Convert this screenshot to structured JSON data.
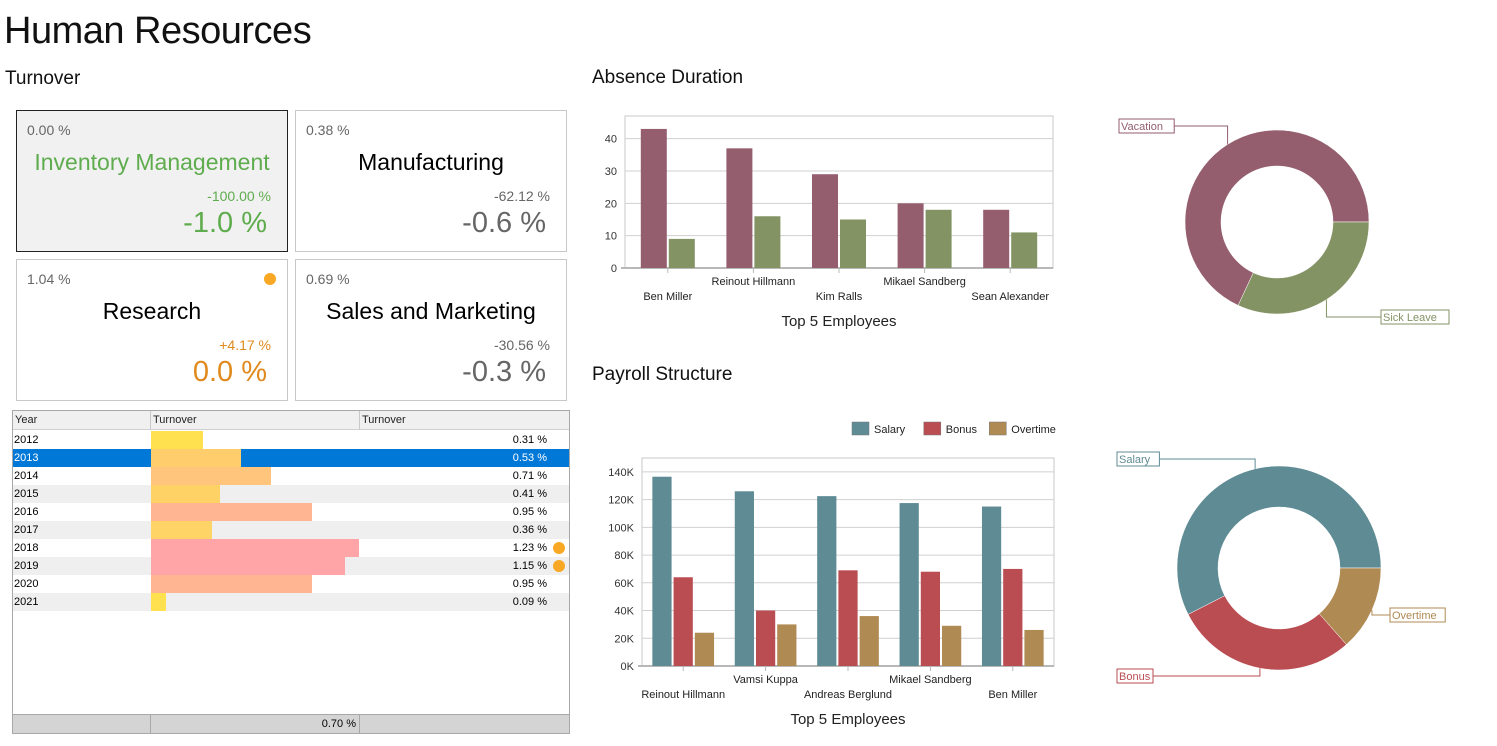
{
  "page": {
    "title": "Human Resources"
  },
  "turnover": {
    "title": "Turnover",
    "cards": [
      {
        "top_value": "0.00 %",
        "name": "Inventory Management",
        "delta": "-100.00 %",
        "value": "-1.0 %",
        "color": "#5fac4e",
        "name_color": "#5fac4e",
        "selected": true,
        "indicator": false
      },
      {
        "top_value": "0.38 %",
        "name": "Manufacturing",
        "delta": "-62.12 %",
        "value": "-0.6 %",
        "color": "#666666",
        "name_color": "#000000",
        "selected": false,
        "indicator": false
      },
      {
        "top_value": "1.04 %",
        "name": "Research",
        "delta": "+4.17 %",
        "value": "0.0 %",
        "color": "#e08a1e",
        "name_color": "#000000",
        "selected": false,
        "indicator": true
      },
      {
        "top_value": "0.69 %",
        "name": "Sales and Marketing",
        "delta": "-30.56 %",
        "value": "-0.3 %",
        "color": "#666666",
        "name_color": "#000000",
        "selected": false,
        "indicator": false
      }
    ],
    "grid": {
      "columns": [
        "Year",
        "Turnover",
        "Turnover"
      ],
      "rows": [
        {
          "year": "2012",
          "value": 0.31,
          "label": "0.31 %",
          "bar_color": "#ffe14f",
          "alert": false
        },
        {
          "year": "2013",
          "value": 0.53,
          "label": "0.53 %",
          "bar_color": "#ffcd6b",
          "alert": false,
          "selected": true
        },
        {
          "year": "2014",
          "value": 0.71,
          "label": "0.71 %",
          "bar_color": "#ffc57d",
          "alert": false
        },
        {
          "year": "2015",
          "value": 0.41,
          "label": "0.41 %",
          "bar_color": "#ffd266",
          "alert": false
        },
        {
          "year": "2016",
          "value": 0.95,
          "label": "0.95 %",
          "bar_color": "#ffb591",
          "alert": false
        },
        {
          "year": "2017",
          "value": 0.36,
          "label": "0.36 %",
          "bar_color": "#ffd466",
          "alert": false
        },
        {
          "year": "2018",
          "value": 1.23,
          "label": "1.23 %",
          "bar_color": "#ffa5a8",
          "alert": true
        },
        {
          "year": "2019",
          "value": 1.15,
          "label": "1.15 %",
          "bar_color": "#ffa5a8",
          "alert": true
        },
        {
          "year": "2020",
          "value": 0.95,
          "label": "0.95 %",
          "bar_color": "#ffb591",
          "alert": false
        },
        {
          "year": "2021",
          "value": 0.09,
          "label": "0.09 %",
          "bar_color": "#ffe14f",
          "alert": false
        }
      ],
      "footer_total": "0.70 %",
      "selected_color": "#0078d7",
      "alert_color": "#f9a825"
    }
  },
  "absence": {
    "title": "Absence Duration"
  },
  "payroll": {
    "title": "Payroll Structure"
  },
  "chart_data": [
    {
      "id": "absence-bar",
      "type": "bar",
      "title": "",
      "xlabel": "Top 5 Employees",
      "ylabel": "",
      "categories": [
        "Ben Miller",
        "Reinout Hillmann",
        "Kim Ralls",
        "Mikael Sandberg",
        "Sean Alexander"
      ],
      "series": [
        {
          "name": "Vacation",
          "color": "#955e6f",
          "values": [
            43,
            37,
            29,
            20,
            18
          ]
        },
        {
          "name": "Sick Leave",
          "color": "#849364",
          "values": [
            9,
            16,
            15,
            18,
            11
          ]
        }
      ],
      "yticks": [
        0,
        10,
        20,
        30,
        40
      ],
      "ytick_labels": [
        "0",
        "10",
        "20",
        "30",
        "40"
      ],
      "ylim": [
        0,
        47
      ],
      "grid": true,
      "legend": "none"
    },
    {
      "id": "absence-donut",
      "type": "pie",
      "donut": true,
      "labels": [
        "Vacation",
        "Sick Leave"
      ],
      "values": [
        147,
        69
      ],
      "colors": [
        "#955e6f",
        "#849364"
      ]
    },
    {
      "id": "payroll-bar",
      "type": "bar",
      "title": "",
      "xlabel": "Top 5 Employees",
      "ylabel": "",
      "categories": [
        "Reinout Hillmann",
        "Vamsi Kuppa",
        "Andreas Berglund",
        "Mikael Sandberg",
        "Ben Miller"
      ],
      "series": [
        {
          "name": "Salary",
          "color": "#5f8b95",
          "values": [
            136500,
            126000,
            122500,
            117500,
            115000
          ]
        },
        {
          "name": "Bonus",
          "color": "#ba4d51",
          "values": [
            64000,
            40000,
            69000,
            68000,
            70000
          ]
        },
        {
          "name": "Overtime",
          "color": "#af8a53",
          "values": [
            24000,
            30000,
            36000,
            29000,
            26000
          ]
        }
      ],
      "yticks": [
        0,
        20000,
        40000,
        60000,
        80000,
        100000,
        120000,
        140000
      ],
      "ytick_labels": [
        "0K",
        "20K",
        "40K",
        "60K",
        "80K",
        "100K",
        "120K",
        "140K"
      ],
      "ylim": [
        0,
        150000
      ],
      "grid": true,
      "legend": "top-right"
    },
    {
      "id": "payroll-donut",
      "type": "pie",
      "donut": true,
      "labels": [
        "Salary",
        "Bonus",
        "Overtime"
      ],
      "values": [
        617500,
        311000,
        145000
      ],
      "colors": [
        "#5f8b95",
        "#ba4d51",
        "#af8a53"
      ]
    }
  ]
}
